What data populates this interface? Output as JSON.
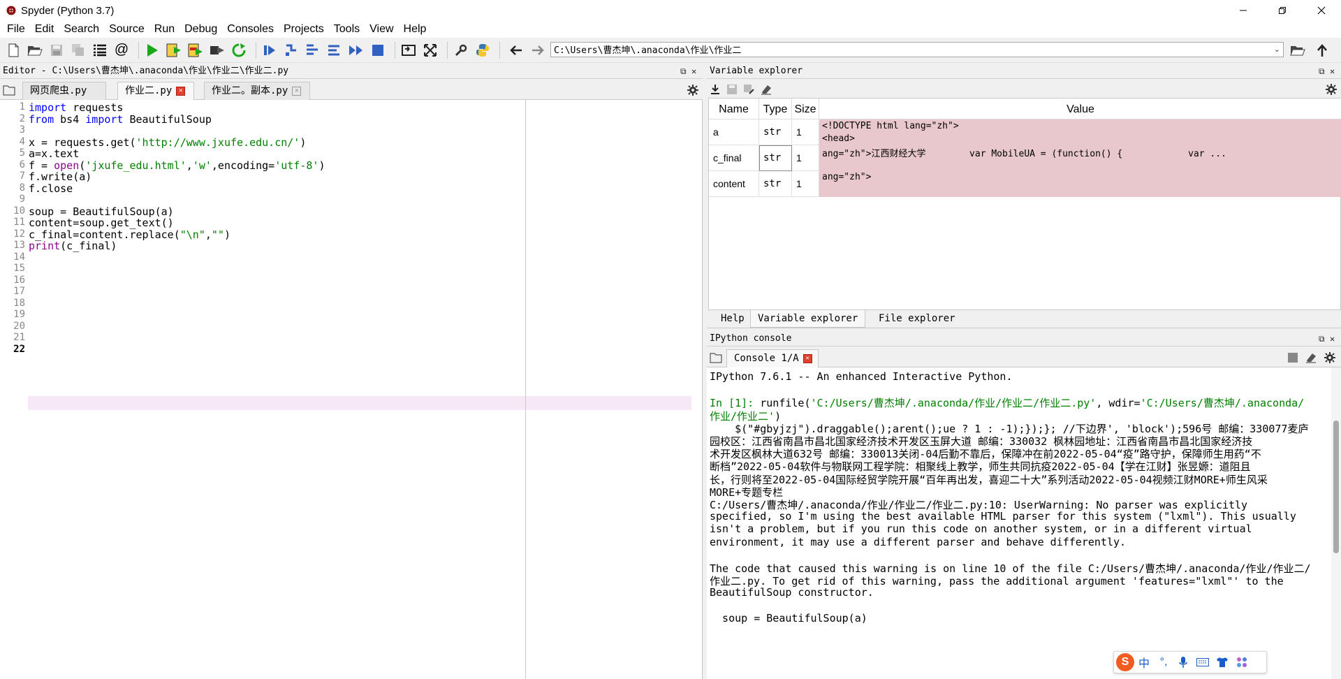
{
  "window": {
    "title": "Spyder (Python 3.7)"
  },
  "menu": [
    "File",
    "Edit",
    "Search",
    "Source",
    "Run",
    "Debug",
    "Consoles",
    "Projects",
    "Tools",
    "View",
    "Help"
  ],
  "toolbar": {
    "path": "C:\\Users\\曹杰坤\\.anaconda\\作业\\作业二"
  },
  "editor": {
    "header": "Editor - C:\\Users\\曹杰坤\\.anaconda\\作业\\作业二\\作业二.py",
    "tabs": [
      "网页爬虫.py",
      "作业二.py",
      "作业二。副本.py"
    ],
    "active_line": "22",
    "line_numbers": [
      "1",
      "2",
      "3",
      "4",
      "5",
      "6",
      "7",
      "8",
      "9",
      "10",
      "11",
      "12",
      "13",
      "14",
      "15",
      "16",
      "17",
      "18",
      "19",
      "20",
      "21",
      "22"
    ],
    "code": [
      [
        {
          "t": "import",
          "c": "kw"
        },
        {
          "t": " requests"
        }
      ],
      [
        {
          "t": "from",
          "c": "kw"
        },
        {
          "t": " bs4 "
        },
        {
          "t": "import",
          "c": "kw"
        },
        {
          "t": " BeautifulSoup"
        }
      ],
      [],
      [
        {
          "t": "x = requests.get("
        },
        {
          "t": "'http://www.jxufe.edu.cn/'",
          "c": "st"
        },
        {
          "t": ")"
        }
      ],
      [
        {
          "t": "a=x.text"
        }
      ],
      [
        {
          "t": "f = "
        },
        {
          "t": "open",
          "c": "bi"
        },
        {
          "t": "("
        },
        {
          "t": "'jxufe_edu.html'",
          "c": "st"
        },
        {
          "t": ","
        },
        {
          "t": "'w'",
          "c": "st"
        },
        {
          "t": ",encoding="
        },
        {
          "t": "'utf-8'",
          "c": "st"
        },
        {
          "t": ")"
        }
      ],
      [
        {
          "t": "f.write(a)"
        }
      ],
      [
        {
          "t": "f.close"
        }
      ],
      [],
      [
        {
          "t": "soup = BeautifulSoup(a)"
        }
      ],
      [
        {
          "t": "content=soup.get_text()"
        }
      ],
      [
        {
          "t": "c_final=content.replace("
        },
        {
          "t": "\"\\n\"",
          "c": "st"
        },
        {
          "t": ","
        },
        {
          "t": "\"\"",
          "c": "st"
        },
        {
          "t": ")"
        }
      ],
      [
        {
          "t": "print",
          "c": "bi"
        },
        {
          "t": "(c_final)"
        }
      ]
    ]
  },
  "variable_explorer": {
    "header": "Variable explorer",
    "columns": [
      "Name",
      "Type",
      "Size",
      "Value"
    ],
    "rows": [
      {
        "name": "a",
        "type": "str",
        "size": "1"
      },
      {
        "name": "c_final",
        "type": "str",
        "size": "1"
      },
      {
        "name": "content",
        "type": "str",
        "size": "1"
      }
    ],
    "value_lines": [
      "<!DOCTYPE html lang=\"zh\">",
      "<head>",
      "ang=\"zh\">江西财经大学        var MobileUA = (function() {            var ...",
      "ang=\"zh\">"
    ],
    "value_color": "#e8c8cc",
    "bottom_tabs": [
      "Help",
      "Variable explorer",
      "File explorer"
    ]
  },
  "console": {
    "header": "IPython console",
    "tab": "Console 1/A",
    "lines": [
      [
        {
          "t": "IPython 7.6.1 -- An enhanced Interactive Python."
        }
      ],
      [],
      [
        {
          "t": "In [",
          "c": "g"
        },
        {
          "t": "1",
          "c": "g"
        },
        {
          "t": "]: ",
          "c": "g"
        },
        {
          "t": "runfile("
        },
        {
          "t": "'C:/Users/曹杰坤/.anaconda/作业/作业二/作业二.py'",
          "c": "g"
        },
        {
          "t": ", wdir="
        },
        {
          "t": "'C:/Users/曹杰坤/.anaconda/",
          "c": "g"
        }
      ],
      [
        {
          "t": "作业/作业二'",
          "c": "g"
        },
        {
          "t": ")"
        }
      ],
      [
        {
          "t": "    $(\"#gbyjzj\").draggable();arent();ue ? 1 : -1);});}; //下边界', 'block');596号 邮编：330077麦庐"
        }
      ],
      [
        {
          "t": "园校区：江西省南昌市昌北国家经济技术开发区玉屏大道 邮编：330032 枫林园地址：江西省南昌市昌北国家经济技"
        }
      ],
      [
        {
          "t": "术开发区枫林大道632号 邮编：330013关闭-04后勤不靠后，保障冲在前2022-05-04“疫”路守护，保障师生用药“不"
        }
      ],
      [
        {
          "t": "断档”2022-05-04软件与物联网工程学院：相聚线上教学，师生共同抗疫2022-05-04【学在江财】张昱嫄：道阻且"
        }
      ],
      [
        {
          "t": "长，行则将至2022-05-04国际经贸学院开展“百年再出发，喜迎二十大”系列活动2022-05-04视频江财MORE+师生风采"
        }
      ],
      [
        {
          "t": "MORE+专题专栏"
        }
      ],
      [
        {
          "t": "C:/Users/曹杰坤/.anaconda/作业/作业二/作业二.py:10: UserWarning: No parser was explicitly"
        }
      ],
      [
        {
          "t": "specified, so I'm using the best available HTML parser for this system (\"lxml\"). This usually"
        }
      ],
      [
        {
          "t": "isn't a problem, but if you run this code on another system, or in a different virtual"
        }
      ],
      [
        {
          "t": "environment, it may use a different parser and behave differently."
        }
      ],
      [],
      [
        {
          "t": "The code that caused this warning is on line 10 of the file C:/Users/曹杰坤/.anaconda/作业/作业二/"
        }
      ],
      [
        {
          "t": "作业二.py. To get rid of this warning, pass the additional argument 'features=\"lxml\"' to the"
        }
      ],
      [
        {
          "t": "BeautifulSoup constructor."
        }
      ],
      [],
      [
        {
          "t": "  soup = BeautifulSoup(a)"
        }
      ]
    ]
  },
  "ime": {
    "logo": "S",
    "lang": "中"
  }
}
